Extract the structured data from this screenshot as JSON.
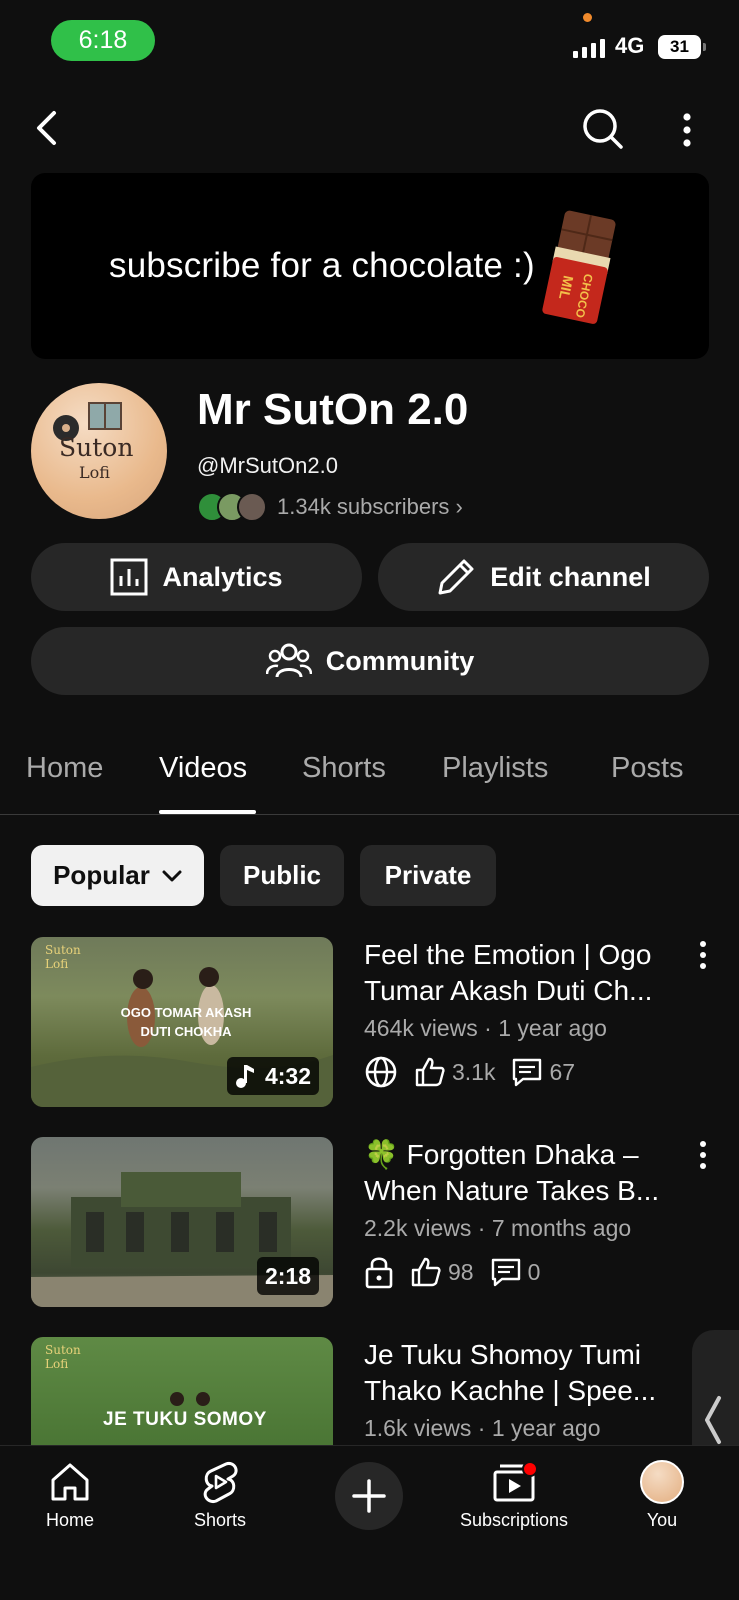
{
  "status_bar": {
    "time": "6:18",
    "network": "4G",
    "battery": "31"
  },
  "banner": {
    "text": "subscribe for a chocolate :)"
  },
  "channel": {
    "name": "Mr SutOn 2.0",
    "handle": "@MrSutOn2.0",
    "subscribers": "1.34k subscribers ›",
    "avatar_title": "Suton",
    "avatar_subtitle": "Lofi"
  },
  "actions": {
    "analytics": "Analytics",
    "edit_channel": "Edit channel",
    "community": "Community"
  },
  "tabs": [
    {
      "label": "Home",
      "active": false
    },
    {
      "label": "Videos",
      "active": true
    },
    {
      "label": "Shorts",
      "active": false
    },
    {
      "label": "Playlists",
      "active": false
    },
    {
      "label": "Posts",
      "active": false
    }
  ],
  "chips": {
    "popular": "Popular",
    "public": "Public",
    "private": "Private"
  },
  "videos": [
    {
      "title": "Feel the Emotion | Ogo Tumar Akash Duti Ch...",
      "meta": "464k views · 1 year ago",
      "duration": "4:32",
      "likes": "3.1k",
      "comments": "67",
      "visibility_icon": "globe-icon",
      "thumb_text": "OGO TOMAR AKASH DUTI CHOKHA"
    },
    {
      "title": "🍀 Forgotten Dhaka – When Nature Takes B...",
      "meta": "2.2k views · 7 months ago",
      "duration": "2:18",
      "likes": "98",
      "comments": "0",
      "visibility_icon": "lock-icon"
    },
    {
      "title": "Je Tuku Shomoy Tumi Thako Kachhe | Spee...",
      "meta": "1.6k views · 1 year ago",
      "thumb_text": "JE TUKU SOMOY"
    }
  ],
  "bottom_nav": {
    "home": "Home",
    "shorts": "Shorts",
    "subscriptions": "Subscriptions",
    "you": "You"
  },
  "colors": {
    "background": "#0f0f0f",
    "surface": "#272727",
    "time_pill": "#30c049",
    "notification": "#ff0000"
  }
}
